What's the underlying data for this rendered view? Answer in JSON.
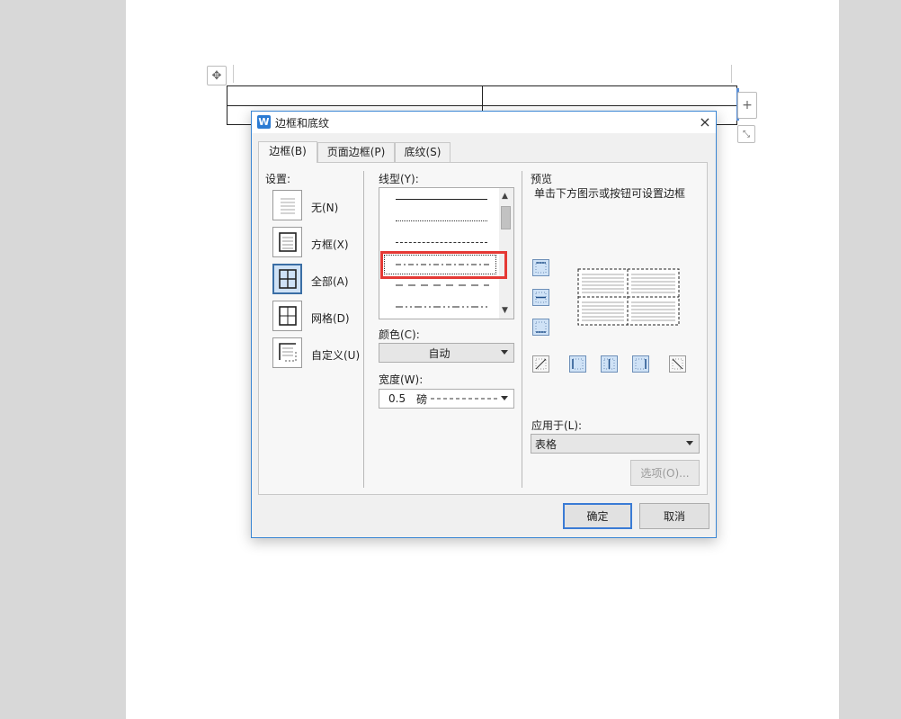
{
  "dialog": {
    "title": "边框和底纹",
    "close_label": "×",
    "app_icon_label": "W"
  },
  "tabs": [
    {
      "label": "边框(B)",
      "active": true
    },
    {
      "label": "页面边框(P)",
      "active": false
    },
    {
      "label": "底纹(S)",
      "active": false
    }
  ],
  "settings": {
    "heading": "设置:",
    "items": [
      {
        "label": "无(N)",
        "icon": "no-border-icon"
      },
      {
        "label": "方框(X)",
        "icon": "box-border-icon"
      },
      {
        "label": "全部(A)",
        "icon": "all-borders-icon",
        "selected": true
      },
      {
        "label": "网格(D)",
        "icon": "grid-border-icon"
      },
      {
        "label": "自定义(U)",
        "icon": "custom-border-icon"
      }
    ]
  },
  "line_style": {
    "heading": "线型(Y):",
    "options": [
      "solid",
      "dotted-fine",
      "dashed-fine",
      "dash-dot",
      "long-dash",
      "dash-dot-dot"
    ],
    "selected_index": 3
  },
  "color": {
    "label": "颜色(C):",
    "value": "自动"
  },
  "width": {
    "label": "宽度(W):",
    "value": "0.5",
    "unit": "磅"
  },
  "preview": {
    "heading": "预览",
    "hint": "单击下方图示或按钮可设置边框"
  },
  "apply_to": {
    "label": "应用于(L):",
    "value": "表格"
  },
  "buttons": {
    "options": "选项(O)...",
    "ok": "确定",
    "cancel": "取消"
  },
  "colors": {
    "accent": "#3a7bd5",
    "annotation_red": "#e53935"
  }
}
